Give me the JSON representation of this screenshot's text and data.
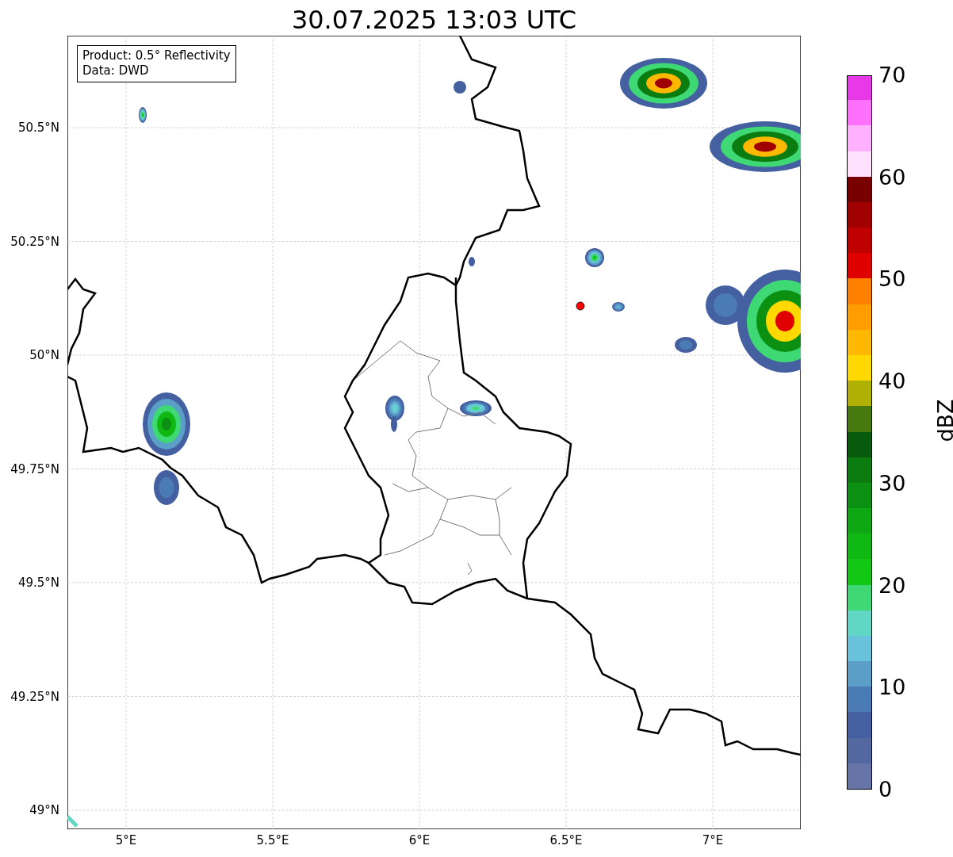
{
  "title": "30.07.2025 13:03 UTC",
  "info_box": [
    "Product: 0.5° Reflectivity",
    "Data: DWD"
  ],
  "lat_ticks": [
    "50.5°N",
    "50.25°N",
    "50°N",
    "49.75°N",
    "49.5°N",
    "49.25°N",
    "49°N"
  ],
  "lon_ticks": [
    "5°E",
    "5.5°E",
    "6°E",
    "6.5°E",
    "7°E"
  ],
  "colorbar": {
    "label": "dBZ",
    "ticks": [
      "70",
      "60",
      "50",
      "40",
      "30",
      "20",
      "10",
      "0"
    ],
    "segments": [
      {
        "color": "#6674a8"
      },
      {
        "color": "#5468a0"
      },
      {
        "color": "#4460a0"
      },
      {
        "color": "#4b7bb5"
      },
      {
        "color": "#5b9ec8"
      },
      {
        "color": "#68c2dc"
      },
      {
        "color": "#62d6c4"
      },
      {
        "color": "#3ed874"
      },
      {
        "color": "#12c814"
      },
      {
        "color": "#10b814"
      },
      {
        "color": "#0ea814"
      },
      {
        "color": "#0c9012"
      },
      {
        "color": "#0b7c10"
      },
      {
        "color": "#085a0c"
      },
      {
        "color": "#467a0e"
      },
      {
        "color": "#b0b004"
      },
      {
        "color": "#ffd800"
      },
      {
        "color": "#ffb800"
      },
      {
        "color": "#ff9c00"
      },
      {
        "color": "#ff8000"
      },
      {
        "color": "#e00000"
      },
      {
        "color": "#c00000"
      },
      {
        "color": "#a00000"
      },
      {
        "color": "#780000"
      },
      {
        "color": "#ffe0ff"
      },
      {
        "color": "#ffb0ff"
      },
      {
        "color": "#ff70ff"
      },
      {
        "color": "#e838e8"
      }
    ]
  }
}
